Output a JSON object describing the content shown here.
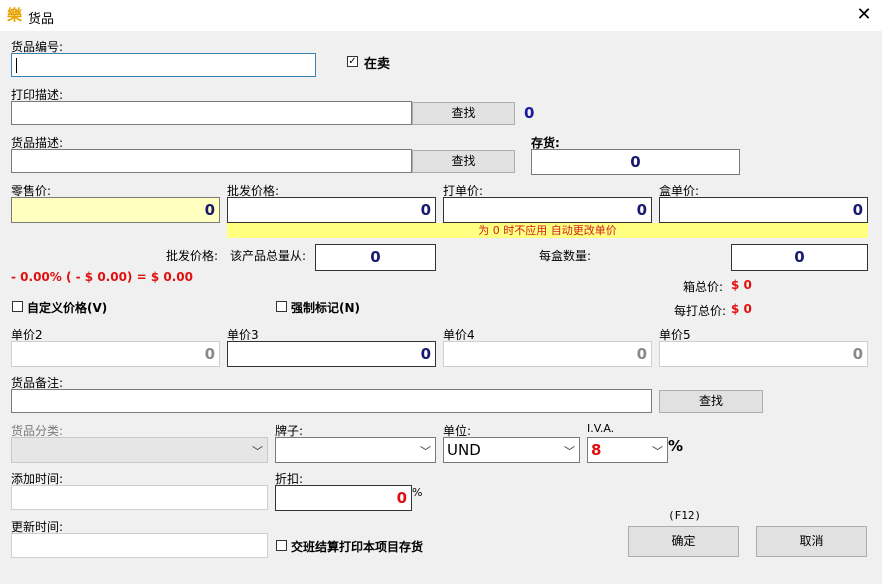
{
  "window": {
    "title": "货品",
    "icon": "app-logo-icon",
    "close": "✕"
  },
  "fields": {
    "code_label": "货品编号:",
    "code_value": "",
    "on_sale_label": "在卖",
    "print_desc_label": "打印描述:",
    "print_desc_value": "",
    "find_label": "查找",
    "print_desc_count": "0",
    "desc_label": "货品描述:",
    "desc_value": "",
    "stock_label": "存货:",
    "stock_value": "0",
    "retail_label": "零售价:",
    "retail_value": "0",
    "wholesale_label": "批发价格:",
    "wholesale_value": "0",
    "dozen_label": "打单价:",
    "dozen_value": "0",
    "box_label": "盒单价:",
    "box_value": "0",
    "warning": "为 0 时不应用 自动更改单价",
    "wholesale_from_label": "批发价格:",
    "total_from_label": "该产品总量从:",
    "total_from_value": "0",
    "per_box_label": "每盒数量:",
    "per_box_value": "0",
    "discount_summary": "- 0.00% ( - $ 0.00) = $ 0.00",
    "box_total_label": "箱总价:",
    "box_total_value": "$ 0",
    "dozen_total_label": "每打总价:",
    "dozen_total_value": "$ 0",
    "custom_price_label": "自定义价格(V)",
    "force_mark_label": "强制标记(N)",
    "unit2_label": "单价2",
    "unit2_value": "0",
    "unit3_label": "单价3",
    "unit3_value": "0",
    "unit4_label": "单价4",
    "unit4_value": "0",
    "unit5_label": "单价5",
    "unit5_value": "0",
    "note_label": "货品备注:",
    "note_value": "",
    "category_label": "货品分类:",
    "category_value": "",
    "brand_label": "牌子:",
    "brand_value": "",
    "unit_label": "单位:",
    "unit_value": "UND",
    "iva_label": "I.V.A.",
    "iva_value": "8",
    "percent": "%",
    "added_label": "添加时间:",
    "added_value": "",
    "discount_label": "折扣:",
    "discount_value": "0",
    "updated_label": "更新时间:",
    "updated_value": "",
    "shift_print_label": "交班结算打印本项目存货",
    "f12_hint": "(F12)",
    "ok_label": "确定",
    "cancel_label": "取消"
  }
}
